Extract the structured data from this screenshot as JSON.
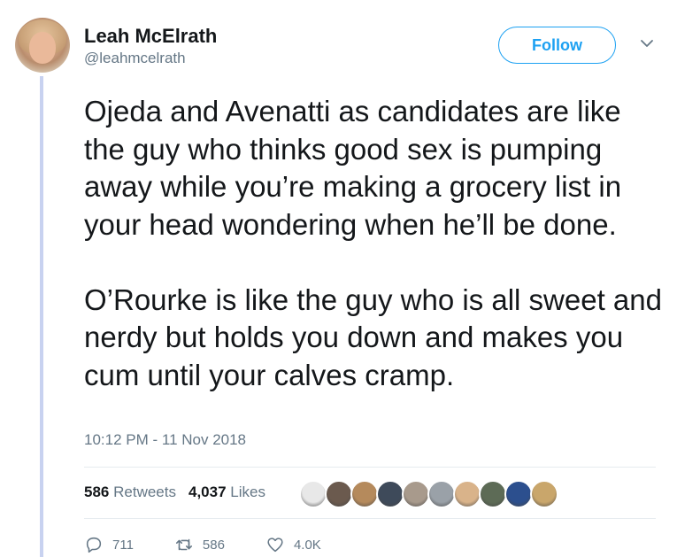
{
  "author": {
    "name": "Leah McElrath",
    "handle": "@leahmcelrath"
  },
  "follow_label": "Follow",
  "tweet": {
    "paragraph1": "Ojeda and Avenatti as candidates are like the guy who thinks good sex is pumping away while you’re making a grocery list in your head wondering when he’ll be done.",
    "paragraph2": "O’Rourke is like the guy who is all sweet and nerdy but holds you down and makes you cum until your calves cramp."
  },
  "timestamp": "10:12 PM - 11 Nov 2018",
  "stats": {
    "retweets_count": "586",
    "retweets_label": "Retweets",
    "likes_count": "4,037",
    "likes_label": "Likes"
  },
  "liker_colors": [
    "#e8e8e8",
    "#6b5a4e",
    "#b58a5c",
    "#3e4a5a",
    "#a89a8c",
    "#9aa1a8",
    "#d9b38a",
    "#5d6b56",
    "#2c4f8e",
    "#c9a66b"
  ],
  "actions": {
    "replies": "711",
    "retweets": "586",
    "likes": "4.0K"
  },
  "colors": {
    "accent": "#1da1f2",
    "muted": "#657786",
    "thread_line": "#c8d2f0"
  }
}
